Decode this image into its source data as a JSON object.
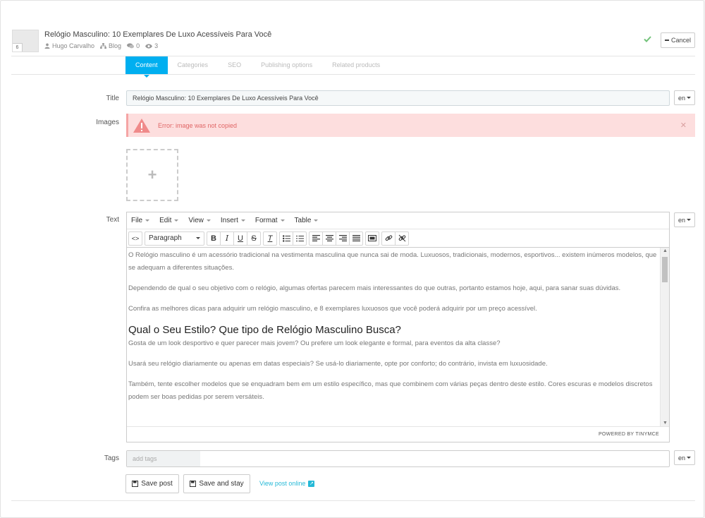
{
  "header": {
    "thumb_count": "6",
    "post_title": "Relógio Masculino: 10 Exemplares De Luxo Acessíveis Para Você",
    "author": "Hugo Carvalho",
    "category": "Blog",
    "comments": "0",
    "views": "3",
    "cancel_label": "Cancel"
  },
  "tabs": [
    {
      "label": "Content"
    },
    {
      "label": "Categories"
    },
    {
      "label": "SEO"
    },
    {
      "label": "Publishing options"
    },
    {
      "label": "Related products"
    }
  ],
  "form": {
    "title_label": "Title",
    "title_value": "Relógio Masculino: 10 Exemplares De Luxo Acessíveis Para Você",
    "lang": "en",
    "images_label": "Images",
    "error_text": "Error: image was not copied",
    "text_label": "Text",
    "tags_label": "Tags",
    "tags_placeholder": "add tags"
  },
  "editor": {
    "menu": [
      "File",
      "Edit",
      "View",
      "Insert",
      "Format",
      "Table"
    ],
    "format_select": "Paragraph",
    "paragraphs": [
      "O Relógio masculino é um acessório tradicional na vestimenta masculina que nunca sai de moda. Luxuosos, tradicionais, modernos, esportivos... existem inúmeros modelos, que se adequam a diferentes situações.",
      "Dependendo de qual o seu objetivo com o relógio, algumas ofertas parecem mais interessantes do que outras, portanto estamos hoje, aqui, para sanar suas dúvidas.",
      "Confira as melhores dicas para adquirir um relógio masculino, e 8 exemplares luxuosos que você poderá adquirir por um preço acessível."
    ],
    "heading": "Qual o Seu Estilo? Que tipo de Relógio Masculino Busca?",
    "paragraphs2": [
      "Gosta de um look desportivo e quer parecer mais jovem? Ou prefere um look elegante e formal, para eventos da alta classe?",
      "Usará seu relógio diariamente ou apenas em datas especiais? Se usá-lo diariamente, opte por conforto; do contrário, invista em luxuosidade.",
      "Também, tente escolher modelos que se enquadram bem em um estilo específico, mas que combinem com várias peças dentro deste estilo. Cores escuras e modelos discretos podem ser boas pedidas por serem versáteis."
    ],
    "powered_by": "POWERED BY TINYMCE"
  },
  "actions": {
    "save_post": "Save post",
    "save_and_stay": "Save and stay",
    "view_online": "View post online"
  },
  "colors": {
    "accent": "#00aff0",
    "error_bg": "#fddede",
    "error_text": "#e06666",
    "success": "#72c279",
    "link": "#25b9d7"
  }
}
